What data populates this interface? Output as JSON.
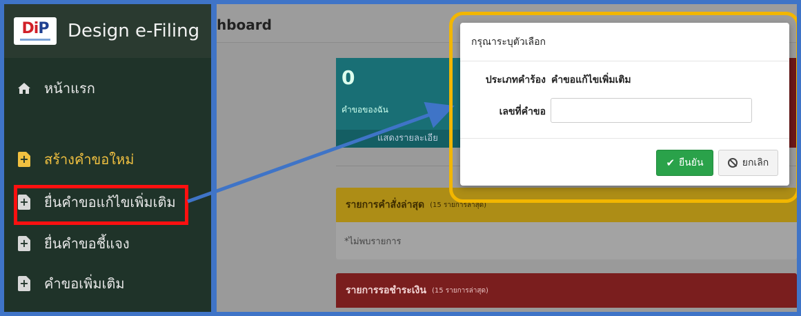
{
  "brand": {
    "logo_text_di": "Di",
    "logo_text_p": "P",
    "title": "Design e-Filing"
  },
  "sidebar": {
    "items": [
      {
        "label": "หน้าแรก",
        "icon": "home-icon"
      },
      {
        "label": "สร้างคำขอใหม่",
        "icon": "file-plus-icon"
      },
      {
        "label": "ยื่นคำขอแก้ไขเพิ่มเติม",
        "icon": "file-plus-icon"
      },
      {
        "label": "ยื่นคำขอชี้แจง",
        "icon": "file-plus-icon"
      },
      {
        "label": "คำขอเพิ่มเติม",
        "icon": "file-plus-icon"
      }
    ]
  },
  "header": {
    "title": "hboard"
  },
  "stat": {
    "count": "0",
    "label": "คำขอของฉัน",
    "details": "แสดงรายละเอีย"
  },
  "panels": {
    "latest_orders": {
      "title": "รายการคำสั่งล่าสุด",
      "subtitle": "(15 รายการล่าสุด)",
      "empty": "*ไม่พบรายการ"
    },
    "pending_payment": {
      "title": "รายการรอชำระเงิน",
      "subtitle": "(15 รายการล่าสุด)"
    }
  },
  "modal": {
    "title": "กรุณาระบุตัวเลือก",
    "type_label": "ประเภทคำร้อง",
    "type_value": "คำขอแก้ไขเพิ่มเติม",
    "number_label": "เลขที่คำขอ",
    "number_value": "",
    "ok_label": "ยืนยัน",
    "cancel_label": "ยกเลิก"
  },
  "colors": {
    "frame": "#3f74c7",
    "highlight_red": "#ff1010",
    "highlight_yellow": "#f2b600",
    "ok_button": "#2aa24a"
  }
}
